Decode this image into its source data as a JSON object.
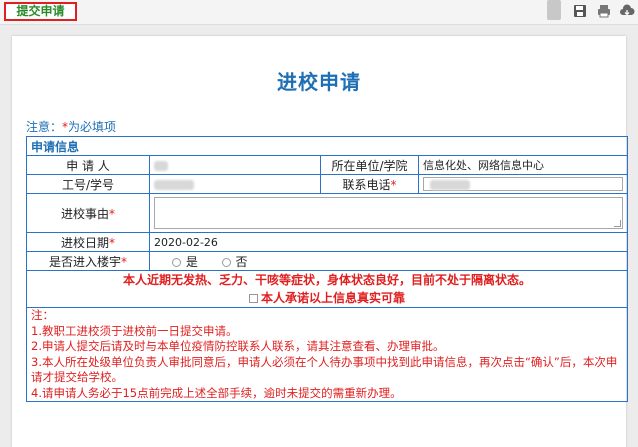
{
  "toolbar": {
    "submit_label": "提交申请",
    "icons": [
      "save-icon",
      "print-icon",
      "cloud-download-icon"
    ]
  },
  "page": {
    "title": "进校申请",
    "required_note_prefix": "注意：",
    "required_note_star": "*",
    "required_note_text": "为必填项"
  },
  "form": {
    "section_title": "申请信息",
    "applicant_label": "申 请 人",
    "unit_label": "所在单位/学院",
    "unit_value": "信息化处、网络信息中心",
    "id_label": "工号/学号",
    "phone_label": "联系电话",
    "reason_label": "进校事由",
    "date_label": "进校日期",
    "date_value": "2020-02-26",
    "building_label": "是否进入楼宇",
    "option_yes": "是",
    "option_no": "否",
    "star": "*"
  },
  "promise": {
    "statement": "本人近期无发热、乏力、干咳等症状，身体状态良好，目前不处于隔离状态。",
    "checkbox_label": "本人承诺以上信息真实可靠"
  },
  "notes": {
    "header": "注：",
    "items": [
      "1.教职工进校须于进校前一日提交申请。",
      "2.申请人提交后请及时与本单位疫情防控联系人联系，请其注意查看、办理审批。",
      "3.本人所在处级单位负责人审批同意后，申请人必须在个人待办事项中找到此申请信息，再次点击“确认”后，本次申请才提交给学校。",
      "4.请申请人务必于15点前完成上述全部手续，逾时未提交的需重新办理。"
    ]
  }
}
